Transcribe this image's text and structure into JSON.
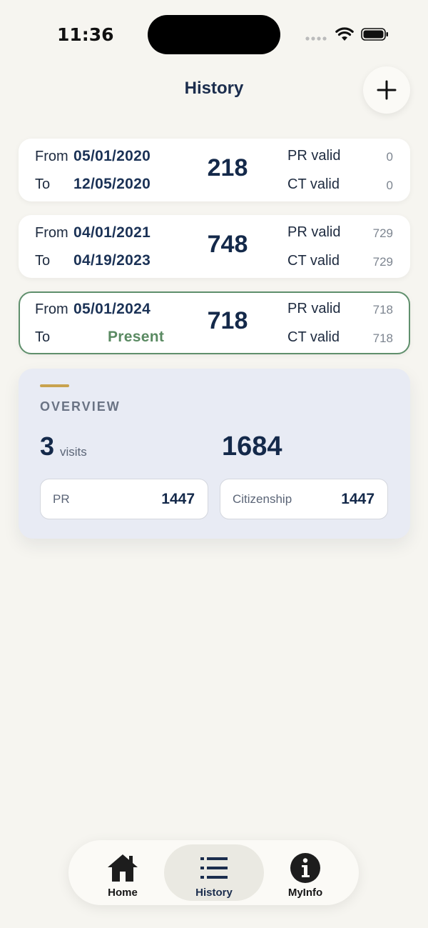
{
  "status_bar": {
    "time": "11:36"
  },
  "header": {
    "title": "History",
    "add_icon": "plus-icon"
  },
  "visits": [
    {
      "from_label": "From",
      "from_date": "05/01/2020",
      "to_label": "To",
      "to_date": "12/05/2020",
      "days": "218",
      "pr_label": "PR valid",
      "pr_value": "0",
      "ct_label": "CT valid",
      "ct_value": "0",
      "active": false
    },
    {
      "from_label": "From",
      "from_date": "04/01/2021",
      "to_label": "To",
      "to_date": "04/19/2023",
      "days": "748",
      "pr_label": "PR valid",
      "pr_value": "729",
      "ct_label": "CT valid",
      "ct_value": "729",
      "active": false
    },
    {
      "from_label": "From",
      "from_date": "05/01/2024",
      "to_label": "To",
      "to_date": "Present",
      "days": "718",
      "pr_label": "PR valid",
      "pr_value": "718",
      "ct_label": "CT valid",
      "ct_value": "718",
      "active": true
    }
  ],
  "overview": {
    "title": "OVERVIEW",
    "visits_count": "3",
    "visits_label": "visits",
    "total_days": "1684",
    "pr_label": "PR",
    "pr_value": "1447",
    "citizenship_label": "Citizenship",
    "citizenship_value": "1447"
  },
  "tabbar": {
    "tabs": [
      {
        "label": "Home",
        "icon": "home-icon",
        "selected": false
      },
      {
        "label": "History",
        "icon": "list-icon",
        "selected": true
      },
      {
        "label": "MyInfo",
        "icon": "info-icon",
        "selected": false
      }
    ]
  },
  "colors": {
    "background": "#f6f5f0",
    "navy": "#14294a",
    "present_green": "#5a8a62",
    "active_border": "#5f8f6c",
    "overview_bg": "#e8ebf4",
    "accent_gold": "#c8a24e"
  }
}
